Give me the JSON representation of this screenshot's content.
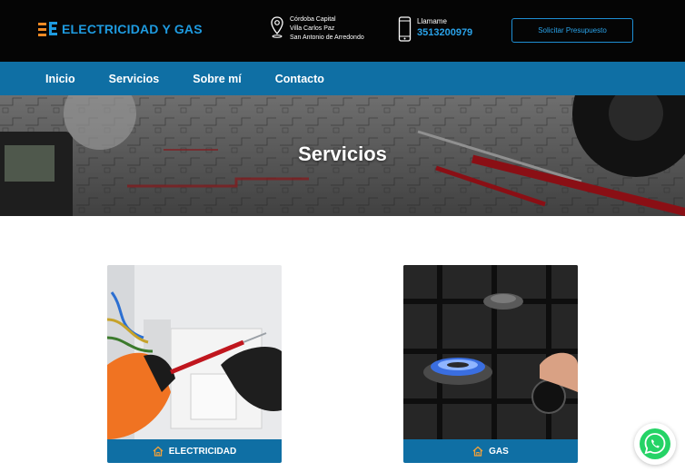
{
  "header": {
    "logo_text": "ELECTRICIDAD Y GAS",
    "locations": [
      "Córdoba Capital",
      "Villa Carlos Paz",
      "San Antonio de Arredondo"
    ],
    "call_label": "Llamame",
    "phone": "3513200979",
    "quote_button": "Solicitar Presupuesto"
  },
  "nav": {
    "items": [
      "Inicio",
      "Servicios",
      "Sobre mí",
      "Contacto"
    ]
  },
  "hero": {
    "title": "Servicios"
  },
  "services": [
    {
      "label": "ELECTRICIDAD",
      "icon": "home-icon"
    },
    {
      "label": "GAS",
      "icon": "home-icon"
    }
  ],
  "colors": {
    "brand_blue": "#0f6fa4",
    "accent_blue": "#1e9be0",
    "logo_orange": "#f08a24",
    "icon_orange": "#f2a23a",
    "whatsapp_green": "#25d366"
  },
  "floating": {
    "icon": "whatsapp-icon"
  }
}
